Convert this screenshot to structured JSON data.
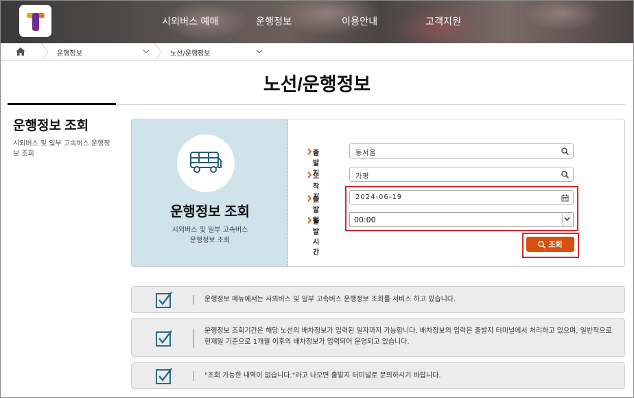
{
  "header": {
    "nav": [
      "시외버스 예매",
      "운행정보",
      "이용안내",
      "고객지원"
    ]
  },
  "breadcrumb": {
    "items": [
      "운행정보",
      "노선/운행정보"
    ]
  },
  "page": {
    "title": "노선/운행정보"
  },
  "sidebar": {
    "title": "운행정보 조회",
    "desc": "시외버스 및 일부 고속버스 운행정보 조회"
  },
  "card": {
    "title": "운행정보 조회",
    "desc_line1": "시외버스 및 일부 고속버스",
    "desc_line2": "운행정보 조회"
  },
  "form": {
    "departure_label": "출발지",
    "departure_value": "동서울",
    "arrival_label": "도착지",
    "arrival_value": "가평",
    "date_label": "출발일",
    "date_value": "2024-06-19",
    "time_label": "출발시간",
    "time_value": "00:00",
    "search_label": "조회"
  },
  "notices": [
    "운행정보 메뉴에서는 시외버스 및 일부 고속버스 운행정보 조회를 서비스 하고 있습니다.",
    "운행정보 조회기간은 해당 노선의 배차정보가 입력된 일자까지 가능합니다. 배차정보의 입력은 출발지 터미널에서 처리하고 있으며, 일반적으로",
    "현재일 기준으로 1개월 이후의 배차정보가 입력되어 운영되고 있습니다.",
    "\"조회 가능한 내역이 없습니다.\"라고 나오면 출발지 터미널로 문의하시기 바랍니다."
  ],
  "colors": {
    "accent": "#d7500f",
    "highlight": "#d7282f",
    "card_panel": "#cfe3ea",
    "check": "#2a6a8a"
  }
}
